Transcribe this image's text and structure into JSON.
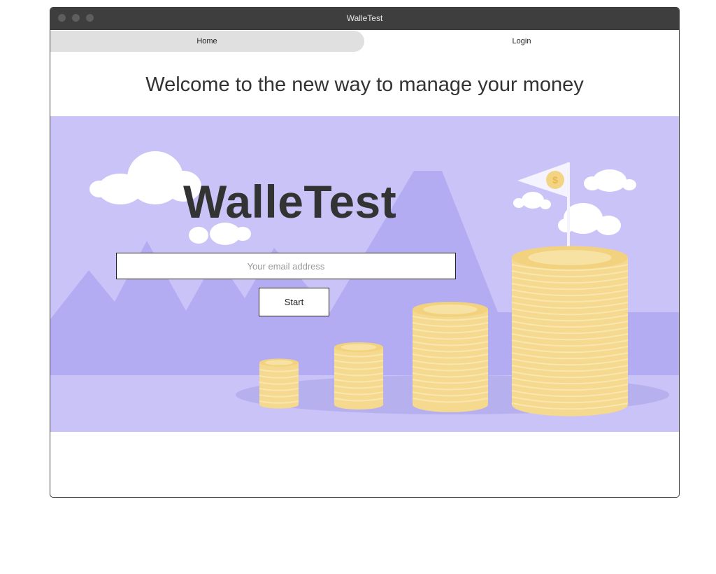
{
  "window": {
    "title": "WalleTest"
  },
  "nav": {
    "home_label": "Home",
    "login_label": "Login"
  },
  "header": {
    "welcome_text": "Welcome to the new way to manage your money"
  },
  "hero": {
    "brand": "WalleTest",
    "email_placeholder": "Your email address",
    "start_label": "Start",
    "colors": {
      "background": "#c9c3f7",
      "mountain": "#b3acf3",
      "coin": "#f6dc94"
    }
  }
}
